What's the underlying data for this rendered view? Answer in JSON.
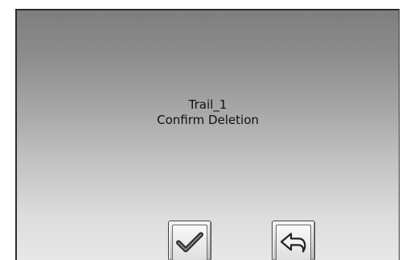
{
  "dialog": {
    "item_name": "Trail_1",
    "prompt": "Confirm Deletion"
  },
  "buttons": {
    "confirm_icon": "checkmark-icon",
    "back_icon": "back-arrow-icon"
  }
}
